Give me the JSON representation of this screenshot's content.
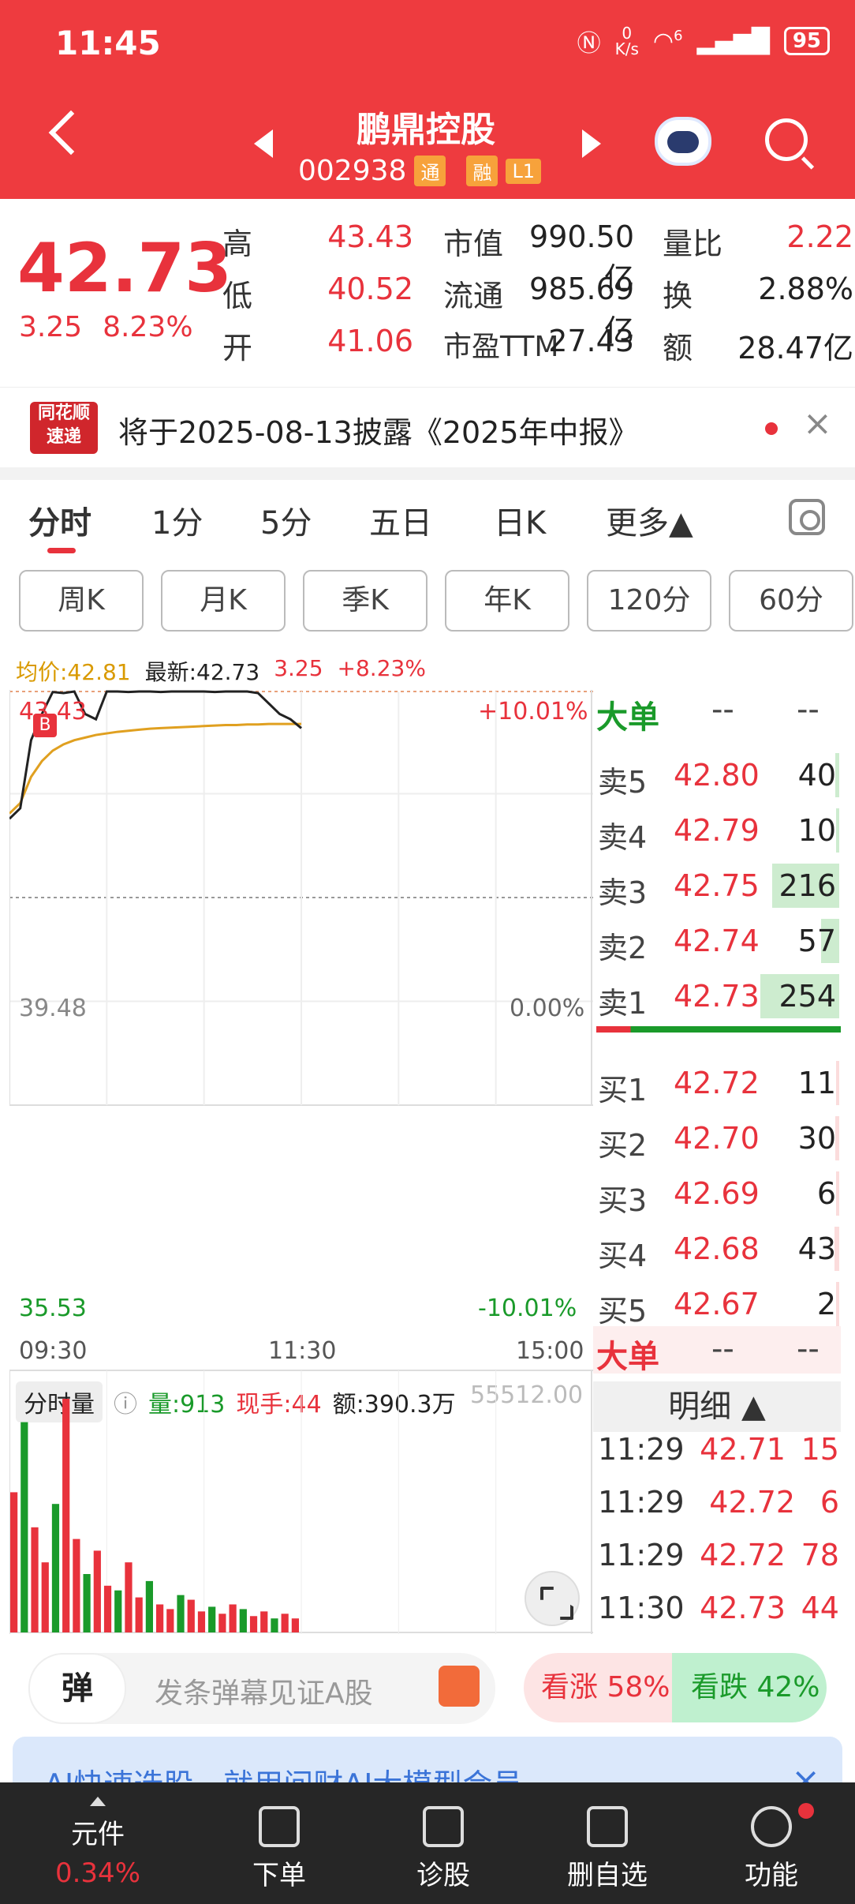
{
  "status": {
    "time": "11:45",
    "speed_top": "0",
    "speed_unit": "K/s",
    "battery": "95",
    "net": "6"
  },
  "header": {
    "name": "鹏鼎控股",
    "code": "002938",
    "tags": [
      "通",
      "融",
      "L1"
    ]
  },
  "quote": {
    "price": "42.73",
    "change": "3.25",
    "change_pct": "8.23%",
    "high_label": "高",
    "high": "43.43",
    "low_label": "低",
    "low": "40.52",
    "open_label": "开",
    "open": "41.06",
    "mcap_label": "市值",
    "mcap": "990.50亿",
    "float_label": "流通",
    "float": "985.69亿",
    "pe_label": "市盈TTM",
    "pe": "27.43",
    "vr_label": "量比",
    "vr": "2.22",
    "turn_label": "换",
    "turn": "2.88%",
    "amt_label": "额",
    "amt": "28.47亿"
  },
  "announcement": {
    "logo_top": "同花顺",
    "logo_bottom": "速递",
    "text": "将于2025-08-13披露《2025年中报》",
    "close": "×"
  },
  "tabs": [
    "分时",
    "1分",
    "5分",
    "五日",
    "日K",
    "更多▲"
  ],
  "periods": [
    "周K",
    "月K",
    "季K",
    "年K",
    "120分",
    "60分"
  ],
  "chart_head": {
    "avg": "均价:42.81",
    "last": "最新:42.73",
    "chg": "3.25",
    "pct": "+8.23%"
  },
  "chart_data": {
    "type": "line",
    "y_top": "43.43",
    "y_mid": "39.48",
    "y_bot": "35.53",
    "pct_top": "+10.01%",
    "pct_mid": "0.00%",
    "pct_bot": "-10.01%",
    "x_labels": [
      "09:30",
      "11:30",
      "15:00"
    ],
    "b_marker": "B",
    "ylim": [
      35.53,
      43.43
    ],
    "price": [
      41.0,
      41.2,
      42.5,
      43.0,
      43.42,
      43.4,
      43.43,
      43.0,
      42.9,
      43.43,
      43.43,
      43.42,
      43.43,
      43.43,
      43.42,
      43.43,
      43.43,
      43.43,
      43.43,
      43.42,
      43.43,
      43.43,
      43.43,
      43.4,
      43.2,
      43.0,
      42.9,
      42.73
    ],
    "avg": [
      41.1,
      41.3,
      41.8,
      42.1,
      42.3,
      42.42,
      42.5,
      42.55,
      42.6,
      42.63,
      42.66,
      42.68,
      42.7,
      42.72,
      42.73,
      42.74,
      42.75,
      42.76,
      42.77,
      42.78,
      42.79,
      42.79,
      42.8,
      42.8,
      42.81,
      42.81,
      42.81,
      42.81
    ],
    "volume": [
      60,
      90,
      45,
      30,
      55,
      100,
      40,
      25,
      35,
      20,
      18,
      30,
      15,
      22,
      12,
      10,
      16,
      14,
      9,
      11,
      8,
      12,
      10,
      7,
      9,
      6,
      8,
      6
    ]
  },
  "orderbook": {
    "big_label": "大单",
    "big_a": "--",
    "big_b": "--",
    "asks": [
      {
        "label": "卖5",
        "price": "42.80",
        "vol": "40",
        "frac": 0.05
      },
      {
        "label": "卖4",
        "price": "42.79",
        "vol": "10",
        "frac": 0.02
      },
      {
        "label": "卖3",
        "price": "42.75",
        "vol": "216",
        "frac": 0.85
      },
      {
        "label": "卖2",
        "price": "42.74",
        "vol": "57",
        "frac": 0.23
      },
      {
        "label": "卖1",
        "price": "42.73",
        "vol": "254",
        "frac": 1.0
      }
    ],
    "bids": [
      {
        "label": "买1",
        "price": "42.72",
        "vol": "11",
        "frac": 0.04
      },
      {
        "label": "买2",
        "price": "42.70",
        "vol": "30",
        "frac": 0.05
      },
      {
        "label": "买3",
        "price": "42.69",
        "vol": "6",
        "frac": 0.02
      },
      {
        "label": "买4",
        "price": "42.68",
        "vol": "43",
        "frac": 0.06
      },
      {
        "label": "买5",
        "price": "42.67",
        "vol": "2",
        "frac": 0.01
      }
    ],
    "big2_label": "大单",
    "big2_a": "--",
    "big2_b": "--"
  },
  "volume_head": {
    "tag": "分时量",
    "vol": "量:913",
    "hand": "现手:44",
    "amt": "额:390.3万",
    "max": "55512.00"
  },
  "detail": {
    "title": "明细 ▲",
    "rows": [
      {
        "time": "11:29",
        "price": "42.71",
        "vol": "15"
      },
      {
        "time": "11:29",
        "price": "42.72",
        "vol": "6"
      },
      {
        "time": "11:29",
        "price": "42.72",
        "vol": "78"
      },
      {
        "time": "11:30",
        "price": "42.73",
        "vol": "44"
      }
    ]
  },
  "barrage": {
    "icon": "弹",
    "placeholder": "发条弹幕见证A股"
  },
  "vote": {
    "up": "看涨 58%",
    "down": "看跌 42%"
  },
  "ai_banner": {
    "text": "AI快速选股，就用问财AI大模型会员",
    "close": "×"
  },
  "nav": {
    "items": [
      "元件",
      "下单",
      "诊股",
      "删自选",
      "功能"
    ],
    "pct": "0.34%"
  },
  "colors": {
    "red": "#e8323c",
    "green": "#1a9a2a",
    "avg_line": "#e0a020",
    "header": "#ee3b3f"
  }
}
